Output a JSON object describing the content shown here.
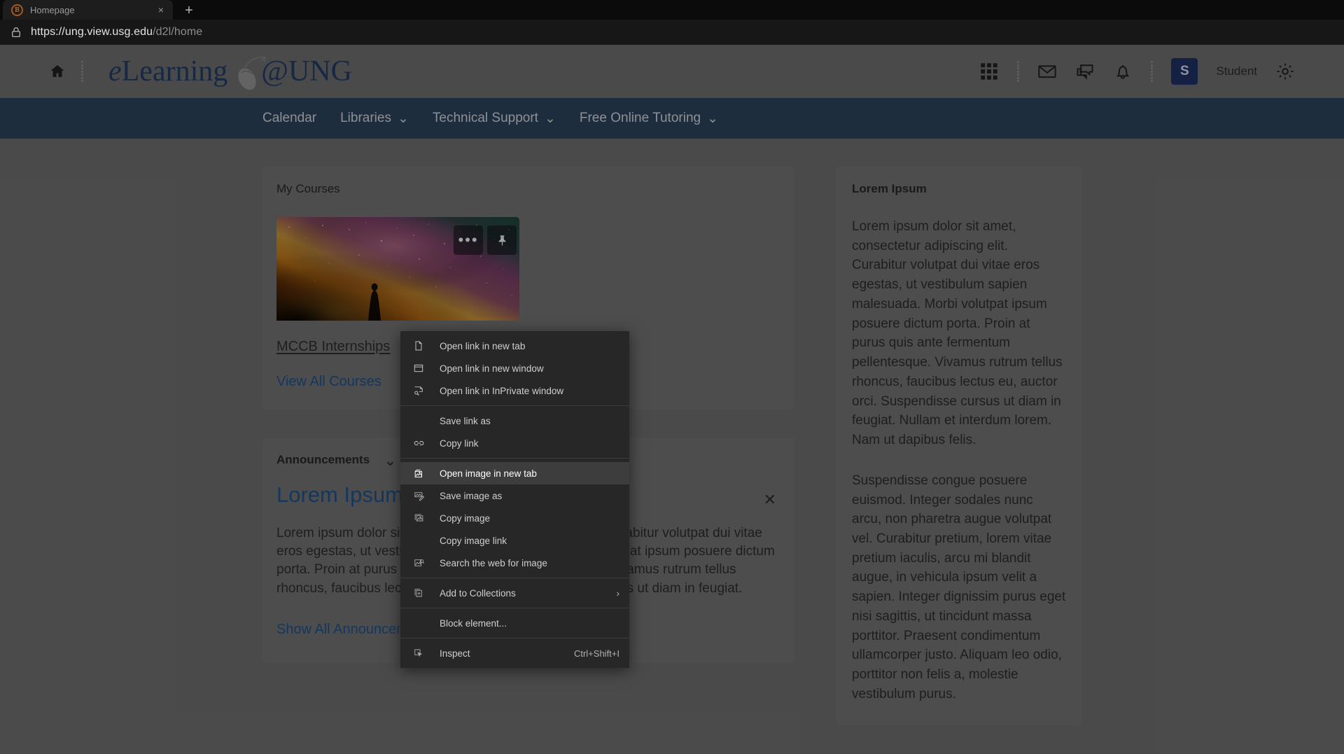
{
  "browser": {
    "tab": {
      "title": "Homepage",
      "favicon": "brightspace-icon",
      "close": "×"
    },
    "new_tab_label": "+",
    "url_scheme_host": "https://ung.view.usg.edu",
    "url_path": "/d2l/home",
    "lock_icon": "lock-icon"
  },
  "header": {
    "home_icon": "home-icon",
    "brand": {
      "e": "e",
      "learning": "Learning",
      "at": "@",
      "ung": "UNG"
    },
    "icons": [
      "waffle-grid-icon",
      "envelope-icon",
      "chat-bubbles-icon",
      "bell-icon"
    ],
    "avatar_initial": "S",
    "user_name": "Student",
    "settings_icon": "gear-icon"
  },
  "nav": {
    "items": [
      {
        "label": "Calendar",
        "caret": false
      },
      {
        "label": "Libraries",
        "caret": true
      },
      {
        "label": "Technical Support",
        "caret": true
      },
      {
        "label": "Free Online Tutoring",
        "caret": true
      }
    ],
    "caret_glyph": "⌄"
  },
  "my_courses": {
    "title": "My Courses",
    "tile_more_label": "•••",
    "tile_pin_label": "pin-icon",
    "course_name": "MCCB Internships",
    "view_all_label": "View All Courses"
  },
  "announcements": {
    "title": "Announcements",
    "collapse_caret": "⌄",
    "close_label": "✕",
    "heading": "Lorem Ipsum",
    "body": "Lorem ipsum dolor sit amet, consectetur adipiscing elit. Curabitur volutpat dui vitae eros egestas, ut vestibulum sapien malesuada. Morbi volutpat ipsum posuere dictum porta. Proin at purus quis ante fermentum pellentesque. Vivamus rutrum tellus rhoncus, faucibus lectus eu, auctor orci. Suspendisse cursus ut diam in feugiat.",
    "show_all_label": "Show All Announcements"
  },
  "sidebar": {
    "title": "Lorem Ipsum",
    "paragraph_1": "Lorem ipsum dolor sit amet, consectetur adipiscing elit. Curabitur volutpat dui vitae eros egestas, ut vestibulum sapien malesuada. Morbi volutpat ipsum posuere dictum porta. Proin at purus quis ante fermentum pellentesque. Vivamus rutrum tellus rhoncus, faucibus lectus eu, auctor orci. Suspendisse cursus ut diam in feugiat. Nullam et interdum lorem. Nam ut dapibus felis.",
    "paragraph_2": "Suspendisse congue posuere euismod. Integer sodales nunc arcu, non pharetra augue volutpat vel. Curabitur pretium, lorem vitae pretium iaculis, arcu mi blandit augue, in vehicula ipsum velit a sapien. Integer dignissim purus eget nisi sagittis, ut tincidunt massa porttitor. Praesent condimentum ullamcorper justo. Aliquam leo odio, porttitor non felis a, molestie vestibulum purus."
  },
  "context_menu": {
    "items": [
      {
        "label": "Open link in new tab",
        "icon": "page-icon",
        "highlighted": false,
        "shortcut": "",
        "submenu": false
      },
      {
        "label": "Open link in new window",
        "icon": "window-icon",
        "highlighted": false,
        "shortcut": "",
        "submenu": false
      },
      {
        "label": "Open link in InPrivate window",
        "icon": "inprivate-icon",
        "highlighted": false,
        "shortcut": "",
        "submenu": false
      },
      {
        "separator": true
      },
      {
        "label": "Save link as",
        "icon": "",
        "highlighted": false,
        "shortcut": "",
        "submenu": false
      },
      {
        "label": "Copy link",
        "icon": "link-icon",
        "highlighted": false,
        "shortcut": "",
        "submenu": false
      },
      {
        "separator": true
      },
      {
        "label": "Open image in new tab",
        "icon": "image-new-tab-icon",
        "highlighted": true,
        "shortcut": "",
        "submenu": false
      },
      {
        "label": "Save image as",
        "icon": "image-save-icon",
        "highlighted": false,
        "shortcut": "",
        "submenu": false
      },
      {
        "label": "Copy image",
        "icon": "image-copy-icon",
        "highlighted": false,
        "shortcut": "",
        "submenu": false
      },
      {
        "label": "Copy image link",
        "icon": "",
        "highlighted": false,
        "shortcut": "",
        "submenu": false
      },
      {
        "label": "Search the web for image",
        "icon": "image-search-icon",
        "highlighted": false,
        "shortcut": "",
        "submenu": false
      },
      {
        "separator": true
      },
      {
        "label": "Add to Collections",
        "icon": "collections-icon",
        "highlighted": false,
        "shortcut": "",
        "submenu": true
      },
      {
        "separator": true
      },
      {
        "label": "Block element...",
        "icon": "",
        "highlighted": false,
        "shortcut": "",
        "submenu": false
      },
      {
        "separator": true
      },
      {
        "label": "Inspect",
        "icon": "inspect-icon",
        "highlighted": false,
        "shortcut": "Ctrl+Shift+I",
        "submenu": false
      }
    ],
    "submenu_arrow": "›"
  },
  "colors": {
    "nav_bar": "#2b4158",
    "page_background": "#6b6b6b",
    "card_background": "#6f6f6f",
    "link_blue": "#1d4f87",
    "brand_navy": "#223a63",
    "menu_background": "#272727",
    "menu_highlight": "#3d3d3d"
  }
}
